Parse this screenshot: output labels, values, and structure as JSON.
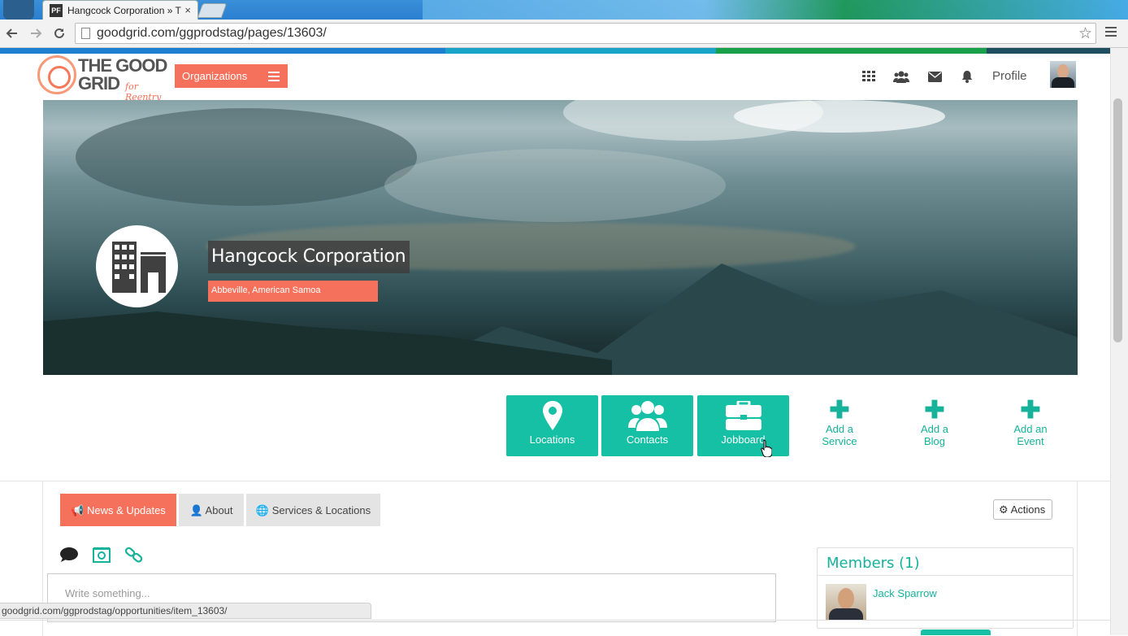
{
  "browser": {
    "tab_title": "Hangcock Corporation » T",
    "favicon_text": "PF",
    "tab_close": "×",
    "url": "goodgrid.com/ggprodstag/pages/13603/",
    "status_url": "goodgrid.com/ggprodstag/opportunities/item_13603/"
  },
  "stripe_colors": [
    "#1c7fd0",
    "#1aa3c9",
    "#18a04a",
    "#1e4e5f"
  ],
  "header": {
    "logo_line1": "THE GOOD",
    "logo_line2": "GRID",
    "logo_tag": "for Reentry",
    "org_menu_label": "Organizations",
    "icons": [
      "grid-icon",
      "users-icon",
      "envelope-icon",
      "bell-icon"
    ],
    "profile_label": "Profile"
  },
  "organization": {
    "name": "Hangcock Corporation",
    "location": "Abbeville, American Samoa"
  },
  "tiles": [
    {
      "label": "Locations",
      "icon": "map-marker-icon"
    },
    {
      "label": "Contacts",
      "icon": "group-icon"
    },
    {
      "label": "Jobboard",
      "icon": "briefcase-icon"
    }
  ],
  "add_actions": [
    {
      "line1": "Add a",
      "line2": "Service"
    },
    {
      "line1": "Add a",
      "line2": "Blog"
    },
    {
      "line1": "Add an",
      "line2": "Event"
    }
  ],
  "tabs": [
    {
      "label": "News & Updates",
      "icon": "bullhorn-icon"
    },
    {
      "label": "About",
      "icon": "user-icon"
    },
    {
      "label": "Services & Locations",
      "icon": "globe-icon"
    }
  ],
  "actions_label": "Actions",
  "compose": {
    "placeholder": "Write something..."
  },
  "members": {
    "title": "Members (1)",
    "list": [
      {
        "name": "Jack Sparrow"
      }
    ]
  },
  "accent_color": "#16c0a4",
  "brand_color": "#f5715b"
}
